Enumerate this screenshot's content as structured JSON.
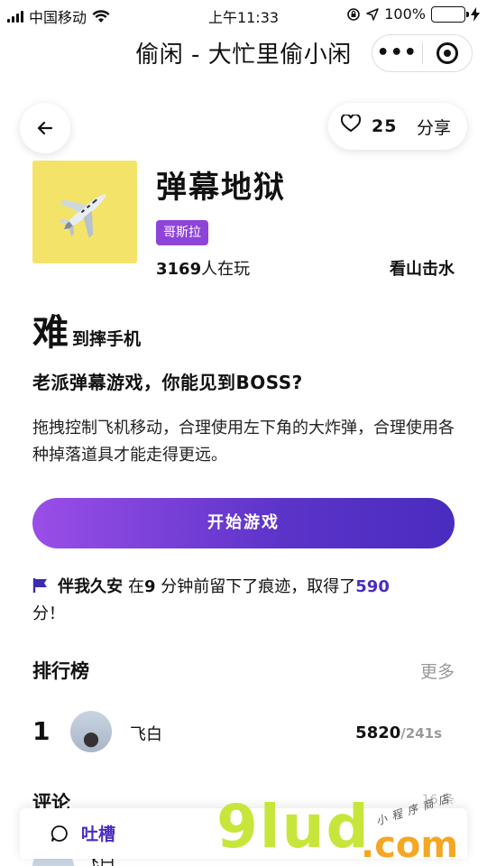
{
  "status_bar": {
    "carrier": "中国移动",
    "time": "上午11:33",
    "battery": "100%"
  },
  "navbar": {
    "title": "偷闲 - 大忙里偷小闲",
    "more_icon": "•••"
  },
  "actions": {
    "like_count": "25",
    "share_label": "分享"
  },
  "game": {
    "name": "弹幕地狱",
    "tag": "哥斯拉",
    "players_count": "3169",
    "players_suffix": "人在玩",
    "author": "看山击水",
    "difficulty_big": "难",
    "difficulty_small": "到摔手机",
    "subtitle": "老派弹幕游戏，你能见到BOSS?",
    "description": "拖拽控制飞机移动，合理使用左下角的大炸弹，合理使用各种掉落道具才能走得更远。",
    "icon_color": "#f3e469"
  },
  "start_button": "开始游戏",
  "activity": {
    "user": "伴我久安",
    "text1": "在",
    "minutes": "9",
    "text2": "分钟前留下了痕迹，取得了",
    "score": "590",
    "text3": "分！"
  },
  "leaderboard": {
    "title": "排行榜",
    "more": "更多",
    "rows": [
      {
        "rank": "1",
        "name": "飞白",
        "score": "5820",
        "time": "/241s"
      }
    ]
  },
  "comments": {
    "title": "评论",
    "count": "16 条",
    "peek_name": "飞白"
  },
  "bottom_bar": {
    "label": "吐槽"
  },
  "watermark": {
    "main": "9lud",
    "dot_com": ".com",
    "small": "小程序商店"
  },
  "colors": {
    "accent": "#4a2cbf",
    "tag": "#8e44d8",
    "gradient_start": "#9a4ee8"
  }
}
